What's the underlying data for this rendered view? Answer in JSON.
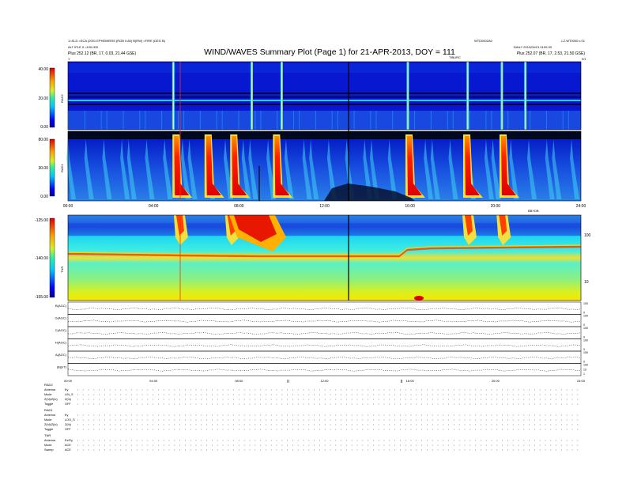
{
  "header": {
    "left_line1": "1=SLD  =SCA (2001 EPHEMERIS (RGB 0.80) B(RW)  =FIRE (DEG B)",
    "left_line2": "ALT IPLE 0  =100,000",
    "left_orbit": "Plus    252.12 (BR, 17, 0.03, 21.44 GSE)",
    "title": "WIND/WAVES Summary Plot (Page 1) for 21-APR-2013, DOY = 111",
    "right_line1": "WTD0002A0",
    "right_line1b": "LZ.WT0000 c.01",
    "right_line2": "DAILY 2013/04/21 0100:33",
    "right_orbit": "Plus    252.07 (BR, 17, 2.53, 21.50 GSE)",
    "ticks_label": "TIBURC",
    "y_left": "Y",
    "y_right": "0/1"
  },
  "panels": {
    "rad2": {
      "label": "RAD2",
      "cbar_max": "40.00",
      "cbar_mid": "20.00",
      "cbar_min": "0.00"
    },
    "rad1": {
      "label": "RAD1",
      "cbar_max": "80.00",
      "cbar_mid": "30.00",
      "cbar_min": "0.00"
    },
    "tnr": {
      "label": "TNR",
      "cbar_max": "-125.00",
      "cbar_mid": "-140.00",
      "cbar_min": "-155.00",
      "axis_label": "BBYDB",
      "right_tick_high": "100",
      "right_tick_low": "10"
    }
  },
  "time_axis": {
    "upper_labels": [
      "00:00",
      "04:00",
      "08:00",
      "12:00",
      "16:00",
      "20:00",
      "24:00"
    ],
    "lower_labels": [
      "00:00",
      "04:00",
      "08:00",
      "12:00",
      "16:00",
      "20:00",
      "24:00"
    ],
    "lower_markers": [
      "II",
      "II"
    ]
  },
  "chart_data": {
    "type": "heatmap",
    "title": "WIND/WAVES Summary Plot (Page 1) for 21-APR-2013, DOY = 111",
    "x_range_hours": [
      0,
      24
    ],
    "panels": [
      {
        "name": "RAD2",
        "colorbar": [
          0,
          40
        ],
        "bursts_hours": [
          4.93,
          8.6,
          10.0,
          15.9,
          18.7,
          20.3,
          21.4
        ]
      },
      {
        "name": "RAD1",
        "colorbar": [
          0,
          80
        ],
        "bursts_hours": [
          5.0,
          6.5,
          7.7,
          9.7,
          15.9,
          18.6,
          20.3
        ]
      },
      {
        "name": "TNR",
        "colorbar": [
          -155,
          -125
        ],
        "bursts_hours": [
          5.1,
          7.5,
          18.6,
          20.2
        ]
      }
    ],
    "strips": [
      {
        "label": "B(AGC)",
        "right_ticks": [
          "100",
          "0"
        ]
      },
      {
        "label": "G(AGC)",
        "right_ticks": [
          "100",
          "0"
        ]
      },
      {
        "label": "C(AGC)",
        "right_ticks": [
          "100",
          "0"
        ]
      },
      {
        "label": "H(AGC)",
        "right_ticks": [
          "100",
          "0"
        ]
      },
      {
        "label": "A(AGC)",
        "right_ticks": [
          "100",
          "0"
        ]
      },
      {
        "label": "|B|(nT)",
        "right_ticks": [
          "100",
          "10",
          "1"
        ]
      }
    ]
  },
  "info": {
    "rad2": {
      "title": "RAD2",
      "rows": [
        [
          "Antenna",
          "Ey"
        ],
        [
          "Mode",
          "LIN_S"
        ],
        [
          "Z(hi)/Z(lo)",
          "Z(hi)"
        ],
        [
          "Toggle",
          "OFF"
        ]
      ]
    },
    "rad1": {
      "title": "RAD1",
      "rows": [
        [
          "Antenna",
          "Ey"
        ],
        [
          "Mode",
          "LOG_S"
        ],
        [
          "Z(hi)/Z(lo)",
          "Z(hi)"
        ],
        [
          "Toggle",
          "OFF"
        ]
      ]
    },
    "tnr": {
      "title": "TNR",
      "rows": [
        [
          "Antenna",
          "Ex/Ey"
        ],
        [
          "Mode",
          "ACE"
        ],
        [
          "Sweep",
          "ACE"
        ]
      ]
    }
  }
}
